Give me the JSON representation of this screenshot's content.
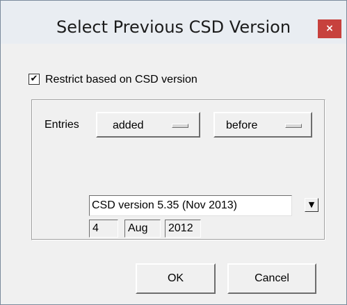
{
  "window": {
    "title": "Select Previous CSD Version",
    "close_glyph": "×"
  },
  "restrict": {
    "checked": true,
    "check_glyph": "✔",
    "label": "Restrict based on CSD version"
  },
  "entries": {
    "label": "Entries",
    "action_option": "added",
    "relation_option": "before"
  },
  "version": {
    "selected": "CSD version 5.35 (Nov 2013)",
    "arrow_glyph": "▼"
  },
  "date": {
    "day": "4",
    "month": "Aug",
    "year": "2012"
  },
  "buttons": {
    "ok_label": "OK",
    "cancel_label": "Cancel"
  },
  "colors": {
    "close_button": "#c7413d",
    "dialog_background": "#f0f0f0",
    "titlebar": "#e9edf2"
  }
}
